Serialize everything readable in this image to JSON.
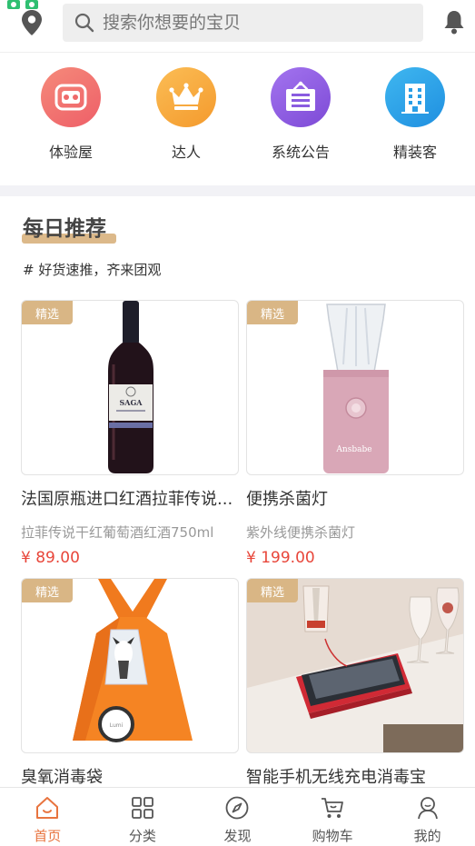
{
  "search": {
    "placeholder": "搜索你想要的宝贝"
  },
  "categories": [
    {
      "label": "体验屋",
      "color": "#f06e6e",
      "icon": "vr-headset-icon"
    },
    {
      "label": "达人",
      "color": "#f7a43c",
      "icon": "crown-icon"
    },
    {
      "label": "系统公告",
      "color": "#8e5ce0",
      "icon": "notice-board-icon"
    },
    {
      "label": "精装客",
      "color": "#2a9ee6",
      "icon": "building-icon"
    }
  ],
  "daily": {
    "title": "每日推荐",
    "subtitle": "# 好货速推，齐来团观"
  },
  "products": [
    {
      "badge": "精选",
      "name": "法国原瓶进口红酒拉菲传说...",
      "desc": "拉菲传说干红葡萄酒红酒750ml",
      "price": "¥ 89.00",
      "image": "red-wine-bottle"
    },
    {
      "badge": "精选",
      "name": "便携杀菌灯",
      "desc": "紫外线便携杀菌灯",
      "price": "¥ 199.00",
      "image": "pink-sterilizer-lamp"
    },
    {
      "badge": "精选",
      "name": "臭氧消毒袋",
      "desc": "",
      "price": "",
      "image": "orange-ozone-bag"
    },
    {
      "badge": "精选",
      "name": "智能手机无线充电消毒宝",
      "desc": "",
      "price": "",
      "image": "red-phone-sterilizer"
    }
  ],
  "nav": {
    "items": [
      {
        "label": "首页",
        "icon": "home-icon",
        "active": true
      },
      {
        "label": "分类",
        "icon": "grid-icon",
        "active": false
      },
      {
        "label": "发现",
        "icon": "compass-icon",
        "active": false
      },
      {
        "label": "购物车",
        "icon": "cart-icon",
        "active": false
      },
      {
        "label": "我的",
        "icon": "user-icon",
        "active": false
      }
    ]
  },
  "colors": {
    "accent": "#e8743f",
    "badge": "#d9b685",
    "price": "#e8463a"
  }
}
